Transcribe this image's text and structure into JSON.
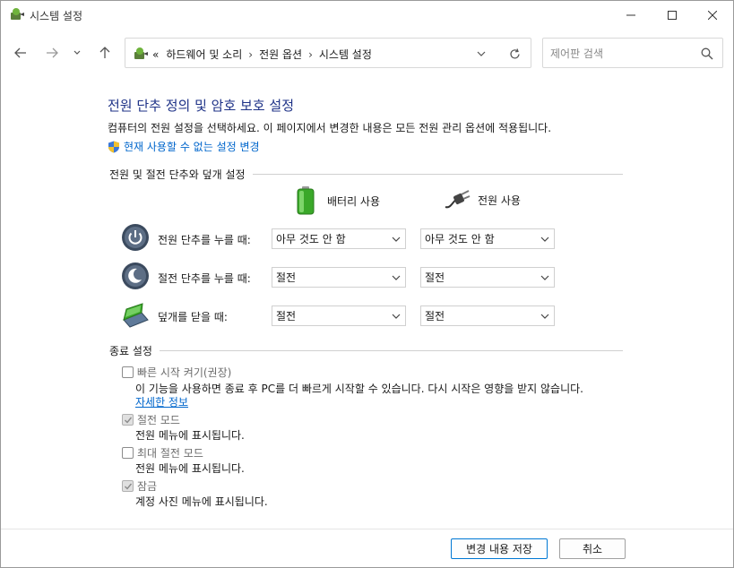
{
  "window": {
    "title": "시스템 설정"
  },
  "address": {
    "prefix": "«",
    "crumbs": [
      "하드웨어 및 소리",
      "전원 옵션",
      "시스템 설정"
    ],
    "separator": "›"
  },
  "search": {
    "placeholder": "제어판 검색"
  },
  "page": {
    "heading": "전원 단추 정의 및 암호 보호 설정",
    "description": "컴퓨터의 전원 설정을 선택하세요. 이 페이지에서 변경한 내용은 모든 전원 관리 옵션에 적용됩니다.",
    "change_link": "현재 사용할 수 없는 설정 변경"
  },
  "power_section": {
    "title": "전원 및 절전 단추와 덮개 설정",
    "col_battery": "배터리 사용",
    "col_plugged": "전원 사용",
    "rows": [
      {
        "label": "전원 단추를 누를 때:",
        "battery": "아무 것도 안 함",
        "plugged": "아무 것도 안 함"
      },
      {
        "label": "절전 단추를 누를 때:",
        "battery": "절전",
        "plugged": "절전"
      },
      {
        "label": "덮개를 닫을 때:",
        "battery": "절전",
        "plugged": "절전"
      }
    ]
  },
  "shutdown_section": {
    "title": "종료 설정",
    "options": [
      {
        "label": "빠른 시작 켜기(권장)",
        "checked": false,
        "description": "이 기능을 사용하면 종료 후 PC를 더 빠르게 시작할 수 있습니다. 다시 시작은 영향을 받지 않습니다.",
        "link": "자세한 정보"
      },
      {
        "label": "절전 모드",
        "checked": true,
        "description": "전원 메뉴에 표시됩니다."
      },
      {
        "label": "최대 절전 모드",
        "checked": false,
        "description": "전원 메뉴에 표시됩니다."
      },
      {
        "label": "잠금",
        "checked": true,
        "description": "계정 사진 메뉴에 표시됩니다."
      }
    ]
  },
  "footer": {
    "save_label": "변경 내용 저장",
    "cancel_label": "취소"
  },
  "colors": {
    "heading": "#1e3287",
    "link": "#0066cc",
    "primary_border": "#0078d4"
  }
}
